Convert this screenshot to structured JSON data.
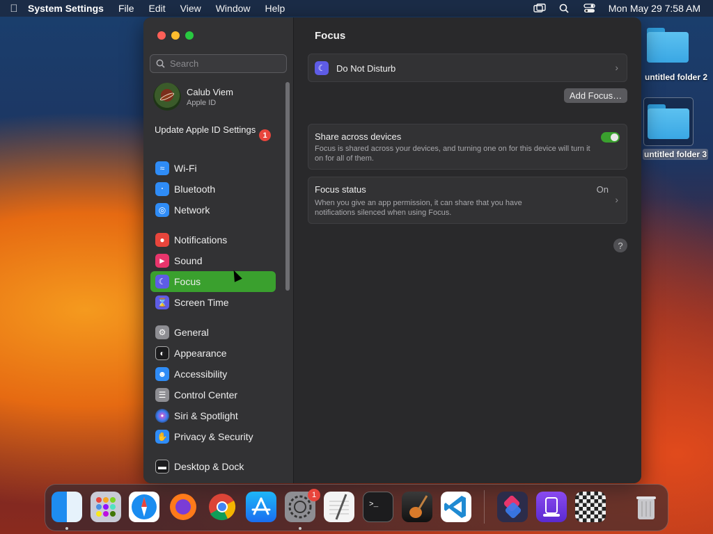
{
  "menubar": {
    "app": "System Settings",
    "menus": [
      "File",
      "Edit",
      "View",
      "Window",
      "Help"
    ],
    "clock": "Mon May 29  7:58 AM"
  },
  "sidebar": {
    "search_placeholder": "Search",
    "profile": {
      "name": "Calub Viem",
      "subtitle": "Apple ID"
    },
    "update": {
      "label": "Update Apple ID Settings",
      "badge": "1"
    },
    "items": [
      {
        "label": "Wi-Fi",
        "icon": "wifi-icon",
        "color": "#2f8cf6"
      },
      {
        "label": "Bluetooth",
        "icon": "bluetooth-icon",
        "color": "#2f8cf6"
      },
      {
        "label": "Network",
        "icon": "globe-icon",
        "color": "#2f8cf6"
      },
      {
        "label": "Notifications",
        "icon": "bell-icon",
        "color": "#e8453c"
      },
      {
        "label": "Sound",
        "icon": "speaker-icon",
        "color": "#e8356c"
      },
      {
        "label": "Focus",
        "icon": "moon-icon",
        "color": "#5e5ce6",
        "selected": true
      },
      {
        "label": "Screen Time",
        "icon": "hourglass-icon",
        "color": "#5e5ce6"
      },
      {
        "label": "General",
        "icon": "gear-icon",
        "color": "#8e8e93"
      },
      {
        "label": "Appearance",
        "icon": "appearance-icon",
        "color": "#1c1c1e"
      },
      {
        "label": "Accessibility",
        "icon": "accessibility-icon",
        "color": "#2f8cf6"
      },
      {
        "label": "Control Center",
        "icon": "control-center-icon",
        "color": "#8e8e93"
      },
      {
        "label": "Siri & Spotlight",
        "icon": "siri-icon",
        "color": "#7a4fd6"
      },
      {
        "label": "Privacy & Security",
        "icon": "hand-icon",
        "color": "#2f8cf6"
      },
      {
        "label": "Desktop & Dock",
        "icon": "dock-icon",
        "color": "#1c1c1e"
      }
    ]
  },
  "content": {
    "title": "Focus",
    "dnd": {
      "label": "Do Not Disturb"
    },
    "add_focus": "Add Focus…",
    "share": {
      "title": "Share across devices",
      "desc": "Focus is shared across your devices, and turning one on for this device will turn it on for all of them.",
      "on": true
    },
    "status": {
      "title": "Focus status",
      "value": "On",
      "desc": "When you give an app permission, it can share that you have notifications silenced when using Focus."
    },
    "help": "?"
  },
  "desktop": {
    "folders": [
      {
        "label": "untitled folder 2"
      },
      {
        "label": "untitled folder 3"
      }
    ]
  },
  "dock": {
    "badge": "1",
    "apps": [
      "finder-icon",
      "launchpad-icon",
      "safari-icon",
      "firefox-icon",
      "chrome-icon",
      "app-store-icon",
      "system-settings-icon",
      "textedit-icon",
      "terminal-icon",
      "garageband-icon",
      "vscode-icon",
      "shortcuts-icon",
      "simulator-icon",
      "chess-icon",
      "trash-icon"
    ]
  }
}
